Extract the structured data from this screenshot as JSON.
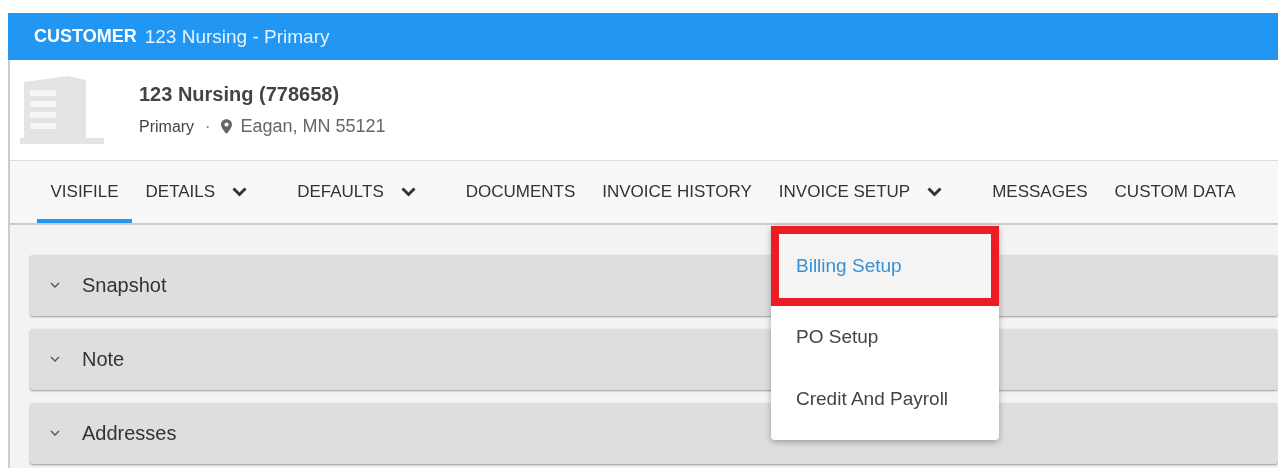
{
  "header": {
    "label": "CUSTOMER",
    "title": "123 Nursing - Primary"
  },
  "customer": {
    "name": "123 Nursing (778658)",
    "type": "Primary",
    "separator": "·",
    "location": "Eagan, MN 55121"
  },
  "tabs": [
    {
      "label": "VISIFILE",
      "selected": true,
      "dropdown": false
    },
    {
      "label": "DETAILS",
      "selected": false,
      "dropdown": true
    },
    {
      "label": "DEFAULTS",
      "selected": false,
      "dropdown": true
    },
    {
      "label": "DOCUMENTS",
      "selected": false,
      "dropdown": false
    },
    {
      "label": "INVOICE HISTORY",
      "selected": false,
      "dropdown": false
    },
    {
      "label": "INVOICE SETUP",
      "selected": false,
      "dropdown": true,
      "expanded": true,
      "menu": [
        {
          "label": "Billing Setup",
          "selected": true
        },
        {
          "label": "PO Setup",
          "selected": false
        },
        {
          "label": "Credit And Payroll",
          "selected": false
        }
      ]
    },
    {
      "label": "MESSAGES",
      "selected": false,
      "dropdown": false
    },
    {
      "label": "CUSTOM DATA",
      "selected": false,
      "dropdown": false
    }
  ],
  "panels": [
    {
      "title": "Snapshot"
    },
    {
      "title": "Note"
    },
    {
      "title": "Addresses"
    }
  ]
}
